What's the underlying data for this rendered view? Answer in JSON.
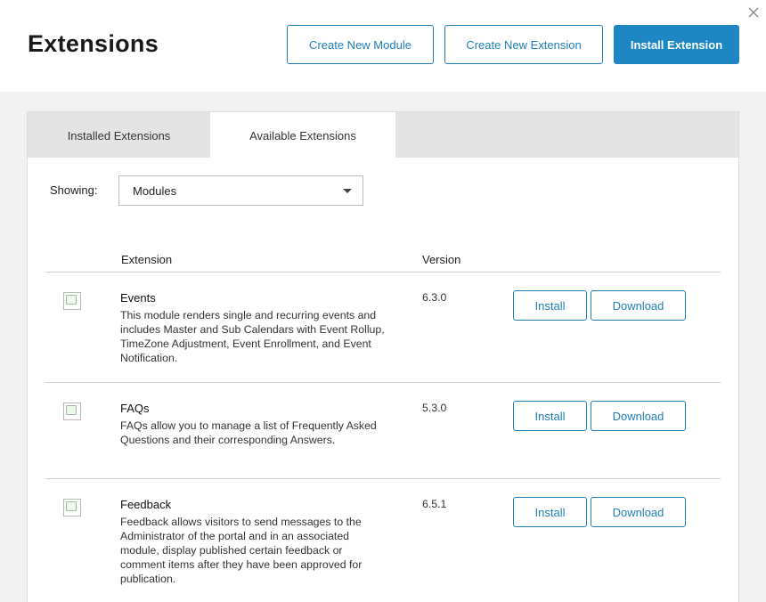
{
  "header": {
    "title": "Extensions",
    "buttons": {
      "create_module": "Create New Module",
      "create_extension": "Create New Extension",
      "install_extension": "Install Extension"
    }
  },
  "tabs": [
    {
      "label": "Installed Extensions",
      "active": false
    },
    {
      "label": "Available Extensions",
      "active": true
    }
  ],
  "filter": {
    "label": "Showing:",
    "selected": "Modules"
  },
  "table": {
    "columns": {
      "extension": "Extension",
      "version": "Version"
    },
    "rows": [
      {
        "name": "Events",
        "description": "This module renders single and recurring events and includes Master and Sub Calendars with Event Rollup, TimeZone Adjustment, Event Enrollment, and Event Notification.",
        "version": "6.3.0",
        "install_label": "Install",
        "download_label": "Download"
      },
      {
        "name": "FAQs",
        "description": "FAQs allow you to manage a list of Frequently Asked Questions and their corresponding Answers.",
        "version": "5.3.0",
        "install_label": "Install",
        "download_label": "Download"
      },
      {
        "name": "Feedback",
        "description": "Feedback allows visitors to send messages to the Administrator of the portal and in an associated module, display published certain feedback or comment items after they have been approved for publication.",
        "version": "6.5.1",
        "install_label": "Install",
        "download_label": "Download"
      }
    ]
  },
  "icons": {
    "close": "close-icon",
    "thumbnail": "broken-image-icon",
    "dropdown": "chevron-down-icon"
  },
  "colors": {
    "accent": "#1e86c3",
    "tab_bar": "#e4e4e4",
    "page_bg": "#f2f2f2"
  }
}
